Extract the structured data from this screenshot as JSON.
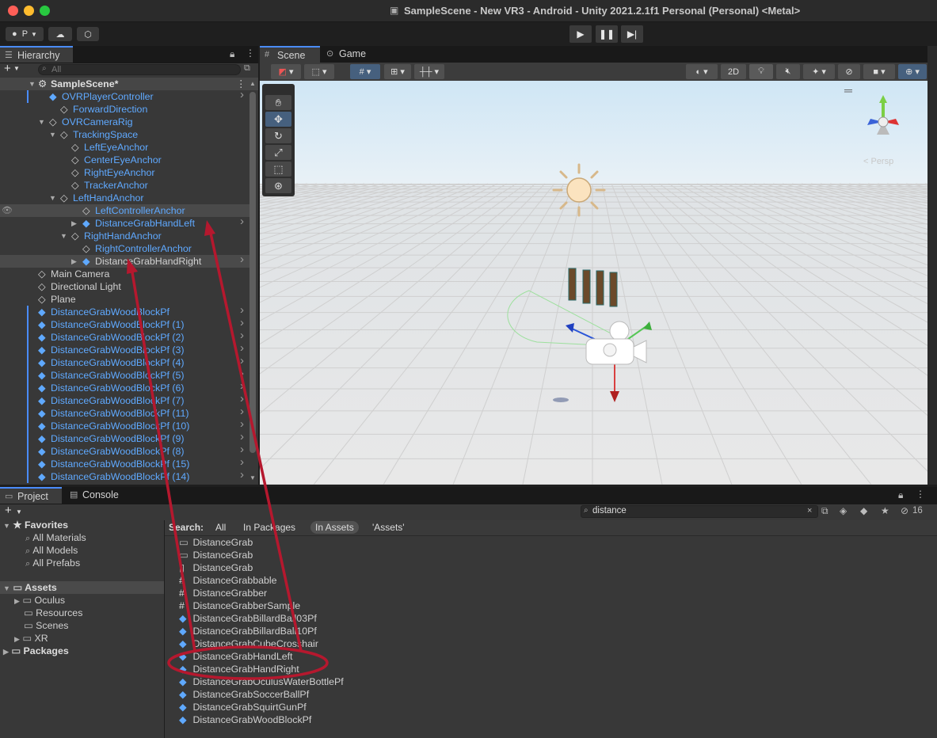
{
  "window": {
    "title": "SampleScene - New VR3 - Android - Unity 2021.2.1f1 Personal (Personal) <Metal>"
  },
  "toolbar": {
    "account_label": "P",
    "layout_label": "2D"
  },
  "hierarchy": {
    "tab": "Hierarchy",
    "search_placeholder": "All",
    "scene_name": "SampleScene*",
    "items": [
      {
        "label": "OVRPlayerController",
        "color": "blue"
      },
      {
        "label": "ForwardDirection",
        "color": "blue"
      },
      {
        "label": "OVRCameraRig",
        "color": "blue"
      },
      {
        "label": "TrackingSpace",
        "color": "blue"
      },
      {
        "label": "LeftEyeAnchor",
        "color": "blue"
      },
      {
        "label": "CenterEyeAnchor",
        "color": "blue"
      },
      {
        "label": "RightEyeAnchor",
        "color": "blue"
      },
      {
        "label": "TrackerAnchor",
        "color": "blue"
      },
      {
        "label": "LeftHandAnchor",
        "color": "blue"
      },
      {
        "label": "LeftControllerAnchor",
        "color": "blue"
      },
      {
        "label": "DistanceGrabHandLeft",
        "color": "blue"
      },
      {
        "label": "RightHandAnchor",
        "color": "blue"
      },
      {
        "label": "RightControllerAnchor",
        "color": "blue"
      },
      {
        "label": "DistanceGrabHandRight",
        "color": "white"
      },
      {
        "label": "Main Camera",
        "color": "white"
      },
      {
        "label": "Directional Light",
        "color": "white"
      },
      {
        "label": "Plane",
        "color": "white"
      },
      {
        "label": "DistanceGrabWoodBlockPf",
        "color": "blue"
      },
      {
        "label": "DistanceGrabWoodBlockPf (1)",
        "color": "blue"
      },
      {
        "label": "DistanceGrabWoodBlockPf (2)",
        "color": "blue"
      },
      {
        "label": "DistanceGrabWoodBlockPf (3)",
        "color": "blue"
      },
      {
        "label": "DistanceGrabWoodBlockPf (4)",
        "color": "blue"
      },
      {
        "label": "DistanceGrabWoodBlockPf (5)",
        "color": "blue"
      },
      {
        "label": "DistanceGrabWoodBlockPf (6)",
        "color": "blue"
      },
      {
        "label": "DistanceGrabWoodBlockPf (7)",
        "color": "blue"
      },
      {
        "label": "DistanceGrabWoodBlockPf (11)",
        "color": "blue"
      },
      {
        "label": "DistanceGrabWoodBlockPf (10)",
        "color": "blue"
      },
      {
        "label": "DistanceGrabWoodBlockPf (9)",
        "color": "blue"
      },
      {
        "label": "DistanceGrabWoodBlockPf (8)",
        "color": "blue"
      },
      {
        "label": "DistanceGrabWoodBlockPf (15)",
        "color": "blue"
      },
      {
        "label": "DistanceGrabWoodBlockPf (14)",
        "color": "blue"
      }
    ]
  },
  "scene": {
    "tab_scene": "Scene",
    "tab_game": "Game",
    "btn_2d": "2D",
    "gizmo_label": "< Persp"
  },
  "project": {
    "tab_project": "Project",
    "tab_console": "Console",
    "search_value": "distance",
    "result_count": "16",
    "search_scope": {
      "label": "Search:",
      "all": "All",
      "in_packages": "In Packages",
      "in_assets": "In Assets",
      "assets": "'Assets'"
    },
    "favorites": {
      "label": "Favorites",
      "items": [
        "All Materials",
        "All Models",
        "All Prefabs"
      ]
    },
    "assets": {
      "label": "Assets",
      "items": [
        "Oculus",
        "Resources",
        "Scenes",
        "XR"
      ]
    },
    "packages": "Packages",
    "files": [
      {
        "name": "DistanceGrab",
        "icon": "folder-icon"
      },
      {
        "name": "DistanceGrab",
        "icon": "folder-icon"
      },
      {
        "name": "DistanceGrab",
        "icon": "scene-file-icon"
      },
      {
        "name": "DistanceGrabbable",
        "icon": "script-icon"
      },
      {
        "name": "DistanceGrabber",
        "icon": "script-icon"
      },
      {
        "name": "DistanceGrabberSample",
        "icon": "script-icon"
      },
      {
        "name": "DistanceGrabBillardBall03Pf",
        "icon": "prefab-icon"
      },
      {
        "name": "DistanceGrabBillardBall10Pf",
        "icon": "prefab-icon"
      },
      {
        "name": "DistanceGrabCubeCrosshair",
        "icon": "prefab-icon"
      },
      {
        "name": "DistanceGrabHandLeft",
        "icon": "prefab-icon"
      },
      {
        "name": "DistanceGrabHandRight",
        "icon": "prefab-icon"
      },
      {
        "name": "DistanceGrabOculusWaterBottlePf",
        "icon": "prefab-icon"
      },
      {
        "name": "DistanceGrabSoccerBallPf",
        "icon": "prefab-icon"
      },
      {
        "name": "DistanceGrabSquirtGunPf",
        "icon": "prefab-icon"
      },
      {
        "name": "DistanceGrabWoodBlockPf",
        "icon": "prefab-icon"
      }
    ]
  },
  "colors": {
    "accent": "#4a8cff",
    "prefab_blue": "#5fa9ff",
    "annotation_red": "#b5182e"
  }
}
